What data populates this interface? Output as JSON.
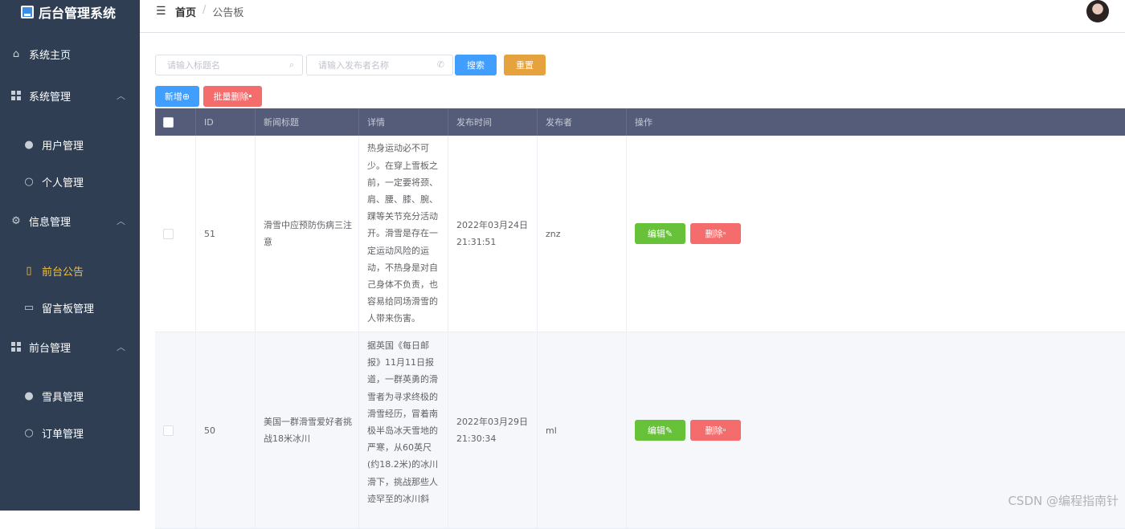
{
  "brand": {
    "title": "后台管理系统"
  },
  "sidebar": {
    "items": [
      {
        "label": "系统主页"
      },
      {
        "label": "系统管理"
      },
      {
        "label": "用户管理"
      },
      {
        "label": "个人管理"
      },
      {
        "label": "信息管理"
      },
      {
        "label": "前台公告"
      },
      {
        "label": "留言板管理"
      },
      {
        "label": "前台管理"
      },
      {
        "label": "雪具管理"
      },
      {
        "label": "订单管理"
      }
    ]
  },
  "header": {
    "breadcrumb": {
      "home": "首页",
      "separator": "/",
      "current": "公告板"
    }
  },
  "search": {
    "title_placeholder": "请输入标题名",
    "publisher_placeholder": "请输入发布者名称",
    "search_label": "搜索",
    "reset_label": "重置"
  },
  "toolbar": {
    "add_label": "新增",
    "batch_delete_label": "批量删除"
  },
  "table": {
    "headers": [
      "ID",
      "新闻标题",
      "详情",
      "发布时间",
      "发布者",
      "操作"
    ],
    "rows": [
      {
        "id": "51",
        "title": "滑雪中应预防伤病三注意",
        "detail": "热身运动必不可少。在穿上雪板之前，一定要将颈、肩、腰、膝、腕、踝等关节充分活动开。滑雪是存在一定运动风险的运动，不热身是对自己身体不负责，也容易给同场滑雪的人带来伤害。",
        "date": "2022年03月24日",
        "time": "21:31:51",
        "publisher": "znz",
        "edit_label": "编辑",
        "delete_label": "删除"
      },
      {
        "id": "50",
        "title": "美国一群滑雪爱好者挑战18米冰川",
        "detail": "据英国《每日邮报》11月11日报道，一群英勇的滑雪者为寻求终极的滑雪经历，冒着南极半岛冰天雪地的严寒，从60英尺(约18.2米)的冰川滑下，挑战那些人迹罕至的冰川斜",
        "date": "2022年03月29日",
        "time": "21:30:34",
        "publisher": "ml",
        "edit_label": "编辑",
        "delete_label": "删除"
      }
    ]
  },
  "watermark": "CSDN @编程指南针",
  "colors": {
    "sidebar": "#2f3e52",
    "table_header": "#545c7a",
    "primary": "#409eff",
    "warning": "#e6a23c",
    "danger": "#f56c6c",
    "success": "#67c23a",
    "active_menu": "#f0c040"
  }
}
